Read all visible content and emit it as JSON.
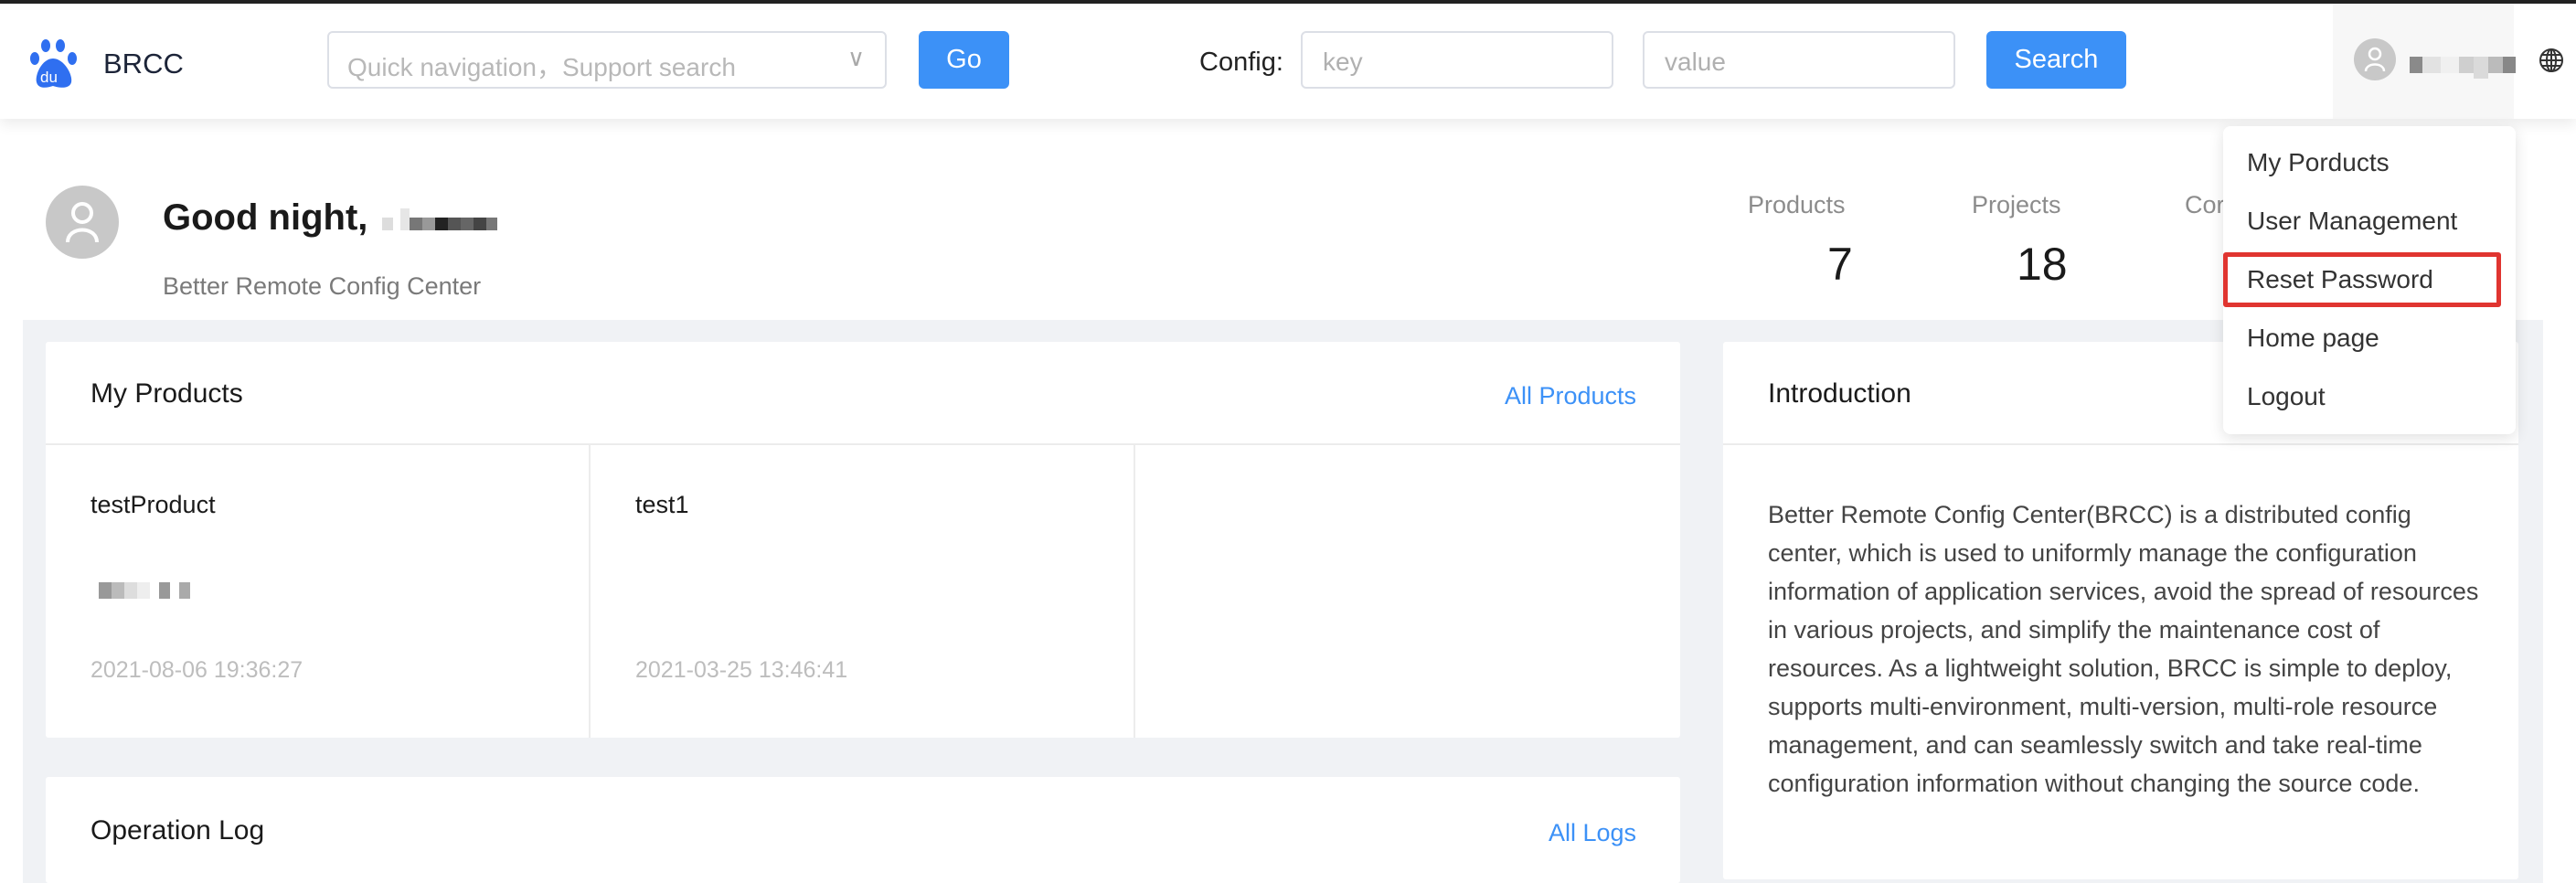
{
  "header": {
    "brand": "BRCC",
    "quick_nav_placeholder": "Quick navigation，Support search",
    "go_label": "Go",
    "config_label": "Config:",
    "key_placeholder": "key",
    "value_placeholder": "value",
    "search_label": "Search"
  },
  "user_menu": {
    "items": [
      "My Porducts",
      "User Management",
      "Reset Password",
      "Home page",
      "Logout"
    ],
    "highlighted": "Reset Password",
    "highlight_color": "#e03530"
  },
  "profile": {
    "greeting": "Good night,",
    "subtitle": "Better Remote Config Center"
  },
  "stats": [
    {
      "label": "Products",
      "value": "7"
    },
    {
      "label": "Projects",
      "value": "18"
    },
    {
      "label": "Cor"
    }
  ],
  "my_products": {
    "title": "My Products",
    "link": "All Products",
    "items": [
      {
        "name": "testProduct",
        "date": "2021-08-06 19:36:27"
      },
      {
        "name": "test1",
        "date": "2021-03-25 13:46:41"
      }
    ]
  },
  "operation_log": {
    "title": "Operation Log",
    "link": "All Logs"
  },
  "introduction": {
    "title": "Introduction",
    "text": "Better Remote Config Center(BRCC) is a distributed config center, which is used to uniformly manage the configuration information of application services, avoid the spread of resources in various projects, and simplify the maintenance cost of resources. As a lightweight solution, BRCC is simple to deploy, supports multi-environment, multi-version, multi-role resource management, and can seamlessly switch and take real-time configuration information without changing the source code."
  },
  "colors": {
    "accent": "#3c91f7",
    "background": "#f0f2f5"
  }
}
